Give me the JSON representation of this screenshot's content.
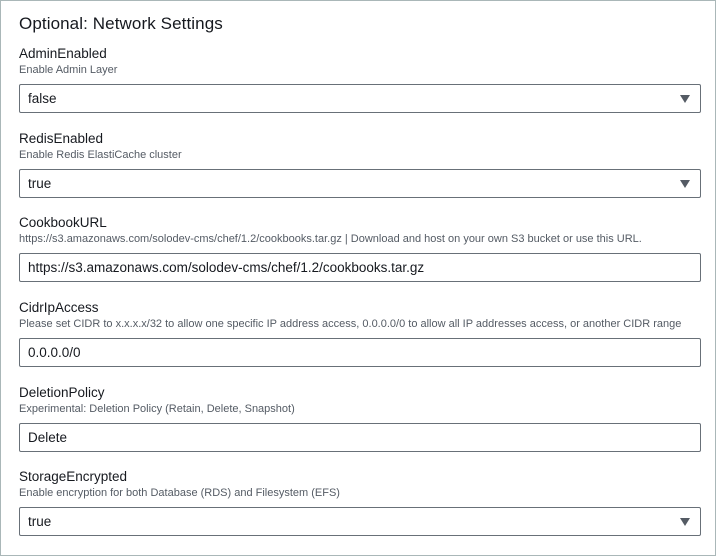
{
  "section": {
    "title": "Optional: Network Settings"
  },
  "fields": [
    {
      "label": "AdminEnabled",
      "description": "Enable Admin Layer",
      "type": "select",
      "value": "false",
      "caret_icon": "caret-down-icon"
    },
    {
      "label": "RedisEnabled",
      "description": "Enable Redis ElastiCache cluster",
      "type": "select",
      "value": "true",
      "caret_icon": "caret-down-icon"
    },
    {
      "label": "CookbookURL",
      "description": "https://s3.amazonaws.com/solodev-cms/chef/1.2/cookbooks.tar.gz | Download and host on your own S3 bucket or use this URL.",
      "type": "text",
      "value": "https://s3.amazonaws.com/solodev-cms/chef/1.2/cookbooks.tar.gz"
    },
    {
      "label": "CidrIpAccess",
      "description": "Please set CIDR to x.x.x.x/32 to allow one specific IP address access, 0.0.0.0/0 to allow all IP addresses access, or another CIDR range",
      "type": "text",
      "value": "0.0.0.0/0"
    },
    {
      "label": "DeletionPolicy",
      "description": "Experimental: Deletion Policy (Retain, Delete, Snapshot)",
      "type": "text",
      "value": "Delete"
    },
    {
      "label": "StorageEncrypted",
      "description": "Enable encryption for both Database (RDS) and Filesystem (EFS)",
      "type": "select",
      "value": "true",
      "caret_icon": "caret-down-icon"
    }
  ],
  "colors": {
    "text": "#16191f",
    "description": "#545b64",
    "border": "#687078",
    "panel_border": "#aab7b8"
  }
}
